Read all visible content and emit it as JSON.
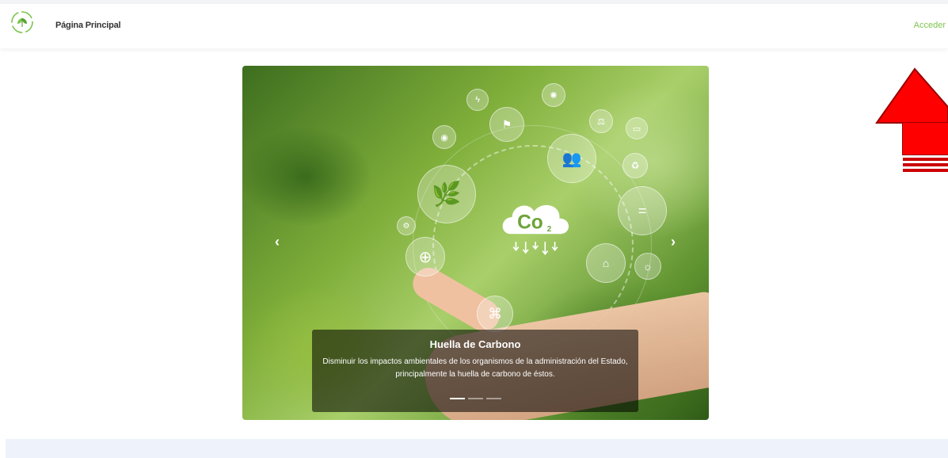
{
  "navbar": {
    "brand": "Página Principal",
    "login_label": "Acceder",
    "logo_icon": "leaf-cycle-icon",
    "accent_color": "#7cc44e"
  },
  "carousel": {
    "slides": [
      {
        "title": "Huella de Carbono",
        "text": "Disminuir los impactos ambientales de los organismos de la administración del Estado, principalmente la huella de carbono de éstos.",
        "cloud_label": "Co",
        "cloud_sub": "2"
      }
    ],
    "active_index": 0,
    "indicator_count": 3,
    "prev_icon": "chevron-left-icon",
    "next_icon": "chevron-right-icon"
  },
  "annotation": {
    "icon": "red-up-arrow-icon",
    "color": "#ff0000"
  }
}
